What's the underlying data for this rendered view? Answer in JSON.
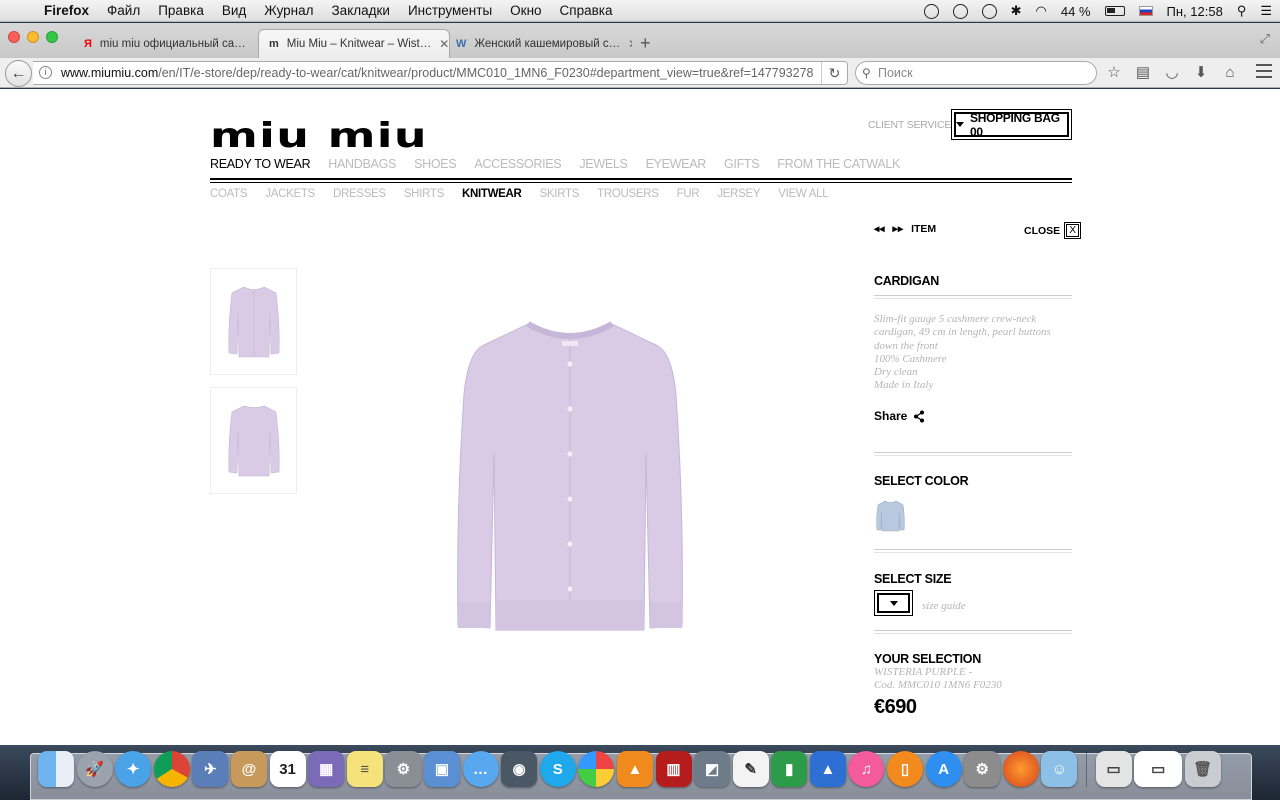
{
  "menubar": {
    "app_name": "Firefox",
    "items": [
      "Файл",
      "Правка",
      "Вид",
      "Журнал",
      "Закладки",
      "Инструменты",
      "Окно",
      "Справка"
    ],
    "battery_text": "44 %",
    "clock": "Пн, 12:58"
  },
  "browser": {
    "tabs": [
      {
        "favicon": "Я",
        "title": "miu miu официальный са…"
      },
      {
        "favicon": "m",
        "title": "Miu Miu – Knitwear – Wist…"
      },
      {
        "favicon": "W",
        "title": "Женский кашемировый с…"
      }
    ],
    "url_domain": "www.miumiu.com",
    "url_path": "/en/IT/e-store/dep/ready-to-wear/cat/knitwear/product/MMC010_1MN6_F0230#department_view=true&ref=147793278",
    "search_placeholder": "Поиск"
  },
  "site": {
    "logo": "miu miu",
    "client_service": "CLIENT SERVICE",
    "shopping_bag": "SHOPPING BAG 00",
    "main_nav": [
      {
        "label": "READY TO WEAR",
        "active": true
      },
      {
        "label": "HANDBAGS",
        "active": false
      },
      {
        "label": "SHOES",
        "active": false
      },
      {
        "label": "ACCESSORIES",
        "active": false
      },
      {
        "label": "JEWELS",
        "active": false
      },
      {
        "label": "EYEWEAR",
        "active": false
      },
      {
        "label": "GIFTS",
        "active": false
      },
      {
        "label": "FROM THE CATWALK",
        "active": false
      }
    ],
    "sub_nav": [
      {
        "label": "COATS",
        "active": false
      },
      {
        "label": "JACKETS",
        "active": false
      },
      {
        "label": "DRESSES",
        "active": false
      },
      {
        "label": "SHIRTS",
        "active": false
      },
      {
        "label": "KNITWEAR",
        "active": true
      },
      {
        "label": "SKIRTS",
        "active": false
      },
      {
        "label": "TROUSERS",
        "active": false
      },
      {
        "label": "FUR",
        "active": false
      },
      {
        "label": "JERSEY",
        "active": false
      },
      {
        "label": "VIEW ALL",
        "active": false
      }
    ]
  },
  "product": {
    "item_label": "ITEM",
    "close_label": "CLOSE",
    "close_box": "X",
    "name": "CARDIGAN",
    "description": [
      "Slim-fit gauge 5 cashmere crew-neck",
      "cardigan, 49 cm in length, pearl buttons",
      "down the front",
      "100% Cashmere",
      "Dry clean",
      "Made in Italy"
    ],
    "share_label": "Share",
    "select_color_label": "SELECT COLOR",
    "select_size_label": "SELECT SIZE",
    "size_guide": "size guide",
    "your_selection_label": "YOUR SELECTION",
    "selection_color": "WISTERIA PURPLE -",
    "selection_code": "Cod. MMC010 1MN6 F0230",
    "price": "€690",
    "cardigan_color": "#d9cbe6",
    "swatch_color": "#b9c8dc"
  },
  "dock": {
    "icons": [
      "finder-icon",
      "launchpad-icon",
      "safari-icon",
      "chrome-icon",
      "preview-icon",
      "contacts-icon",
      "calendar-icon",
      "photos-icon",
      "notes-icon",
      "tools-icon",
      "iphoto-icon",
      "messages-icon",
      "facetime-icon",
      "skype-icon",
      "pinwheel-icon",
      "vlc-icon",
      "photo-booth-icon",
      "image-capture-icon",
      "textedit-icon",
      "numbers-icon",
      "keynote-icon",
      "itunes-icon",
      "ibooks-icon",
      "app-store-icon",
      "system-preferences-icon",
      "firefox-icon",
      "user-icon",
      "document-icon",
      "window-icon",
      "trash-icon"
    ],
    "calendar_day": "31"
  }
}
